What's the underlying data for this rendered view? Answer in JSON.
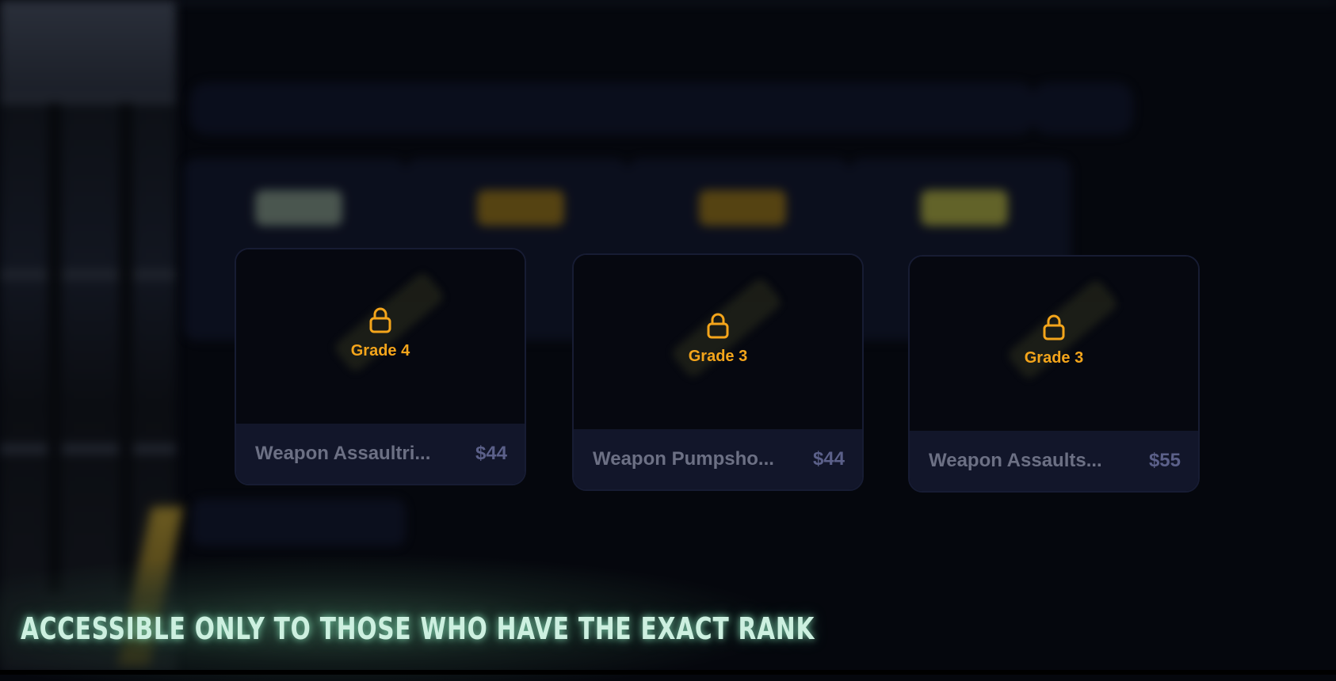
{
  "background": {
    "title": "",
    "search_placeholder": "",
    "sort_label": "",
    "cart_title": ""
  },
  "cards": [
    {
      "grade": "Grade 4",
      "name": "Weapon Assaultri...",
      "price": "$44"
    },
    {
      "grade": "Grade 3",
      "name": "Weapon Pumpsho...",
      "price": "$44"
    },
    {
      "grade": "Grade 3",
      "name": "Weapon Assaults...",
      "price": "$55"
    }
  ],
  "caption": "ACCESSIBLE ONLY TO THOSE WHO HAVE THE EXACT RANK",
  "colors": {
    "grade": "#f4a51b",
    "card_bg": "#070a13",
    "card_footer": "#12162a",
    "caption": "#cdf0e0"
  },
  "icons": [
    "lock-icon"
  ]
}
